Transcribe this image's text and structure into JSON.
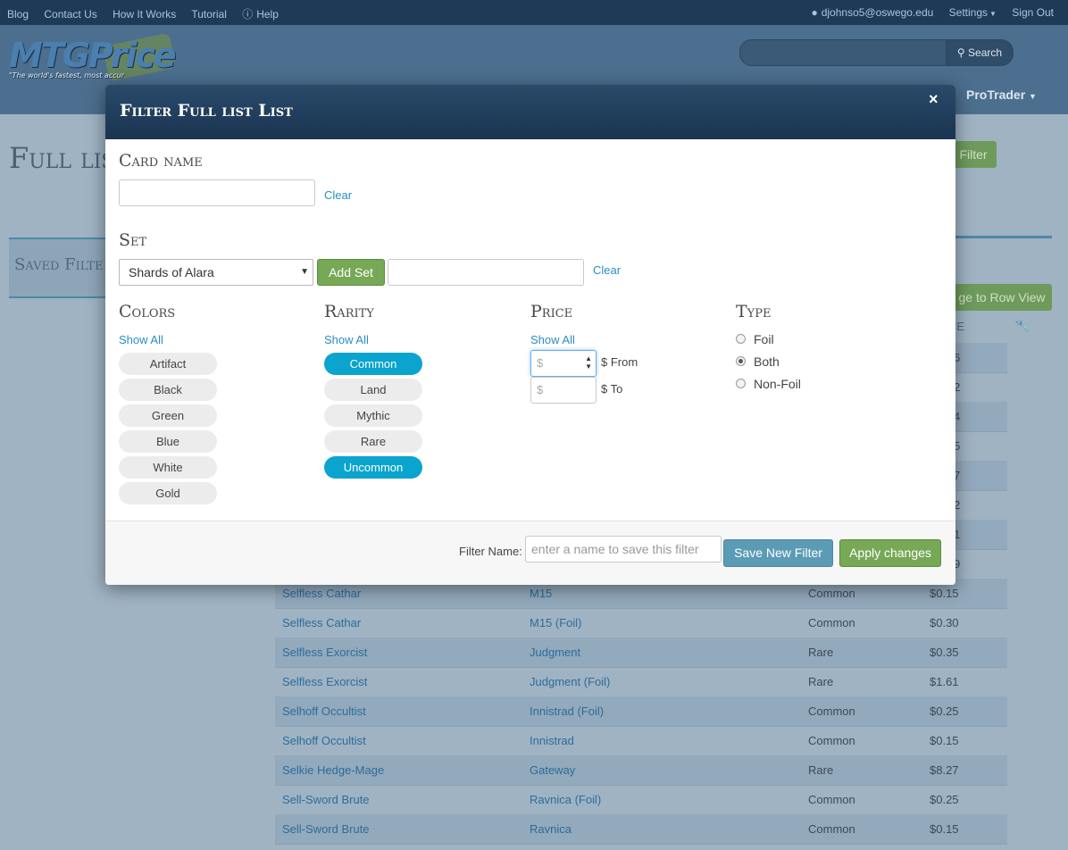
{
  "topbar": {
    "links": [
      "Blog",
      "Contact Us",
      "How It Works",
      "Tutorial",
      "Help"
    ],
    "user": "djohnso5@oswego.edu",
    "settings": "Settings",
    "signout": "Sign Out"
  },
  "header": {
    "logo": "MTGPrice",
    "tagline": "\"The world's fastest, most accur",
    "search_label": "Search",
    "protrader": "ProTrader"
  },
  "page": {
    "title": "Full lis",
    "filter_btn": "Filter",
    "saved_filters": "Saved Filte",
    "row_view": "ge to Row View",
    "price_header": "CE"
  },
  "table": {
    "rows": [
      {
        "name": "Selfless Cathar",
        "set": "M15",
        "rarity": "Common",
        "price": "$0.15"
      },
      {
        "name": "Selfless Cathar",
        "set": "M15 (Foil)",
        "rarity": "Common",
        "price": "$0.30"
      },
      {
        "name": "Selfless Exorcist",
        "set": "Judgment",
        "rarity": "Rare",
        "price": "$0.35"
      },
      {
        "name": "Selfless Exorcist",
        "set": "Judgment (Foil)",
        "rarity": "Rare",
        "price": "$1.61"
      },
      {
        "name": "Selhoff Occultist",
        "set": "Innistrad (Foil)",
        "rarity": "Common",
        "price": "$0.25"
      },
      {
        "name": "Selhoff Occultist",
        "set": "Innistrad",
        "rarity": "Common",
        "price": "$0.15"
      },
      {
        "name": "Selkie Hedge-Mage",
        "set": "Gateway",
        "rarity": "Rare",
        "price": "$8.27"
      },
      {
        "name": "Sell-Sword Brute",
        "set": "Ravnica (Foil)",
        "rarity": "Common",
        "price": "$0.25"
      },
      {
        "name": "Sell-Sword Brute",
        "set": "Ravnica",
        "rarity": "Common",
        "price": "$0.15"
      }
    ],
    "hidden_prices": [
      "6",
      "2",
      "4",
      "5",
      "7",
      "2",
      "1",
      "9"
    ]
  },
  "modal": {
    "title": "Filter Full list List",
    "card_name": {
      "label": "Card name",
      "value": "",
      "clear": "Clear"
    },
    "set": {
      "label": "Set",
      "selected": "Shards of Alara",
      "add": "Add Set",
      "clear": "Clear"
    },
    "colors": {
      "label": "Colors",
      "show_all": "Show All",
      "items": [
        "Artifact",
        "Black",
        "Green",
        "Blue",
        "White",
        "Gold"
      ]
    },
    "rarity": {
      "label": "Rarity",
      "show_all": "Show All",
      "items": [
        {
          "label": "Common",
          "on": true
        },
        {
          "label": "Land",
          "on": false
        },
        {
          "label": "Mythic",
          "on": false
        },
        {
          "label": "Rare",
          "on": false
        },
        {
          "label": "Uncommon",
          "on": true
        }
      ]
    },
    "price": {
      "label": "Price",
      "show_all": "Show All",
      "placeholder": "$",
      "from": "$ From",
      "to": "$ To"
    },
    "type": {
      "label": "Type",
      "options": [
        "Foil",
        "Both",
        "Non-Foil"
      ],
      "selected": "Both"
    },
    "footer": {
      "filter_name_label": "Filter Name:",
      "filter_name_placeholder": "enter a name to save this filter",
      "save": "Save New Filter",
      "apply": "Apply changes"
    }
  },
  "colors": {
    "accent": "#0aa4cf",
    "green": "#77a856",
    "blue_btn": "#5b9bb5",
    "header": "#1a3450"
  }
}
